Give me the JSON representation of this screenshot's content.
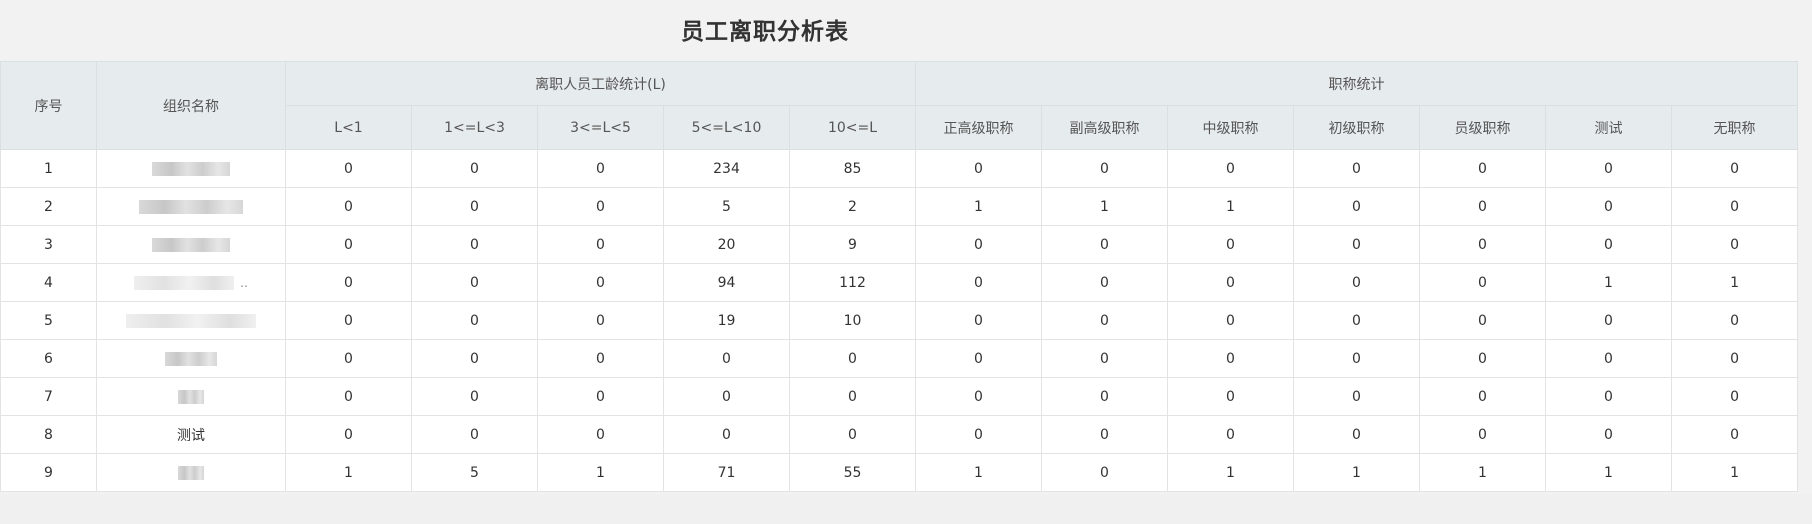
{
  "page": {
    "title": "员工离职分析表"
  },
  "table": {
    "col_seq": "序号",
    "col_org": "组织名称",
    "group_age": "离职人员工龄统计(L)",
    "group_title": "职称统计",
    "age_cols": [
      "L<1",
      "1<=L<3",
      "3<=L<5",
      "5<=L<10",
      "10<=L"
    ],
    "title_cols": [
      "正高级职称",
      "副高级职称",
      "中级职称",
      "初级职称",
      "员级职称",
      "测试",
      "无职称"
    ],
    "rows": [
      {
        "seq": "1",
        "org": "",
        "values": [
          "0",
          "0",
          "0",
          "234",
          "85",
          "0",
          "0",
          "0",
          "0",
          "0",
          "0",
          "0"
        ]
      },
      {
        "seq": "2",
        "org": "",
        "values": [
          "0",
          "0",
          "0",
          "5",
          "2",
          "1",
          "1",
          "1",
          "0",
          "0",
          "0",
          "0"
        ]
      },
      {
        "seq": "3",
        "org": "",
        "values": [
          "0",
          "0",
          "0",
          "20",
          "9",
          "0",
          "0",
          "0",
          "0",
          "0",
          "0",
          "0"
        ]
      },
      {
        "seq": "4",
        "org": "",
        "values": [
          "0",
          "0",
          "0",
          "94",
          "112",
          "0",
          "0",
          "0",
          "0",
          "0",
          "1",
          "1"
        ]
      },
      {
        "seq": "5",
        "org": "",
        "values": [
          "0",
          "0",
          "0",
          "19",
          "10",
          "0",
          "0",
          "0",
          "0",
          "0",
          "0",
          "0"
        ]
      },
      {
        "seq": "6",
        "org": "",
        "values": [
          "0",
          "0",
          "0",
          "0",
          "0",
          "0",
          "0",
          "0",
          "0",
          "0",
          "0",
          "0"
        ]
      },
      {
        "seq": "7",
        "org": "",
        "values": [
          "0",
          "0",
          "0",
          "0",
          "0",
          "0",
          "0",
          "0",
          "0",
          "0",
          "0",
          "0"
        ]
      },
      {
        "seq": "8",
        "org": "测试",
        "values": [
          "0",
          "0",
          "0",
          "0",
          "0",
          "0",
          "0",
          "0",
          "0",
          "0",
          "0",
          "0"
        ]
      },
      {
        "seq": "9",
        "org": "",
        "values": [
          "1",
          "5",
          "1",
          "71",
          "55",
          "1",
          "0",
          "1",
          "1",
          "1",
          "1",
          "1"
        ]
      }
    ]
  }
}
